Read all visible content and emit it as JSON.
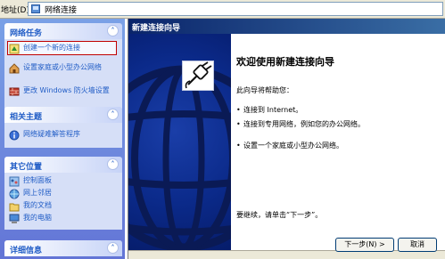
{
  "address_bar": {
    "label": "地址(D)",
    "path": "网络连接"
  },
  "task_pane": {
    "network_tasks": {
      "title": "网络任务",
      "items": [
        {
          "label": "创建一个新的连接",
          "icon": "new-connection-icon"
        },
        {
          "label": "设置家庭或小型办公网络",
          "icon": "home-network-icon"
        },
        {
          "label": "更改 Windows 防火墙设置",
          "icon": "firewall-icon"
        }
      ]
    },
    "related_topics": {
      "title": "相关主题",
      "items": [
        {
          "label": "网络疑难解答程序",
          "icon": "info-icon"
        }
      ]
    },
    "other_places": {
      "title": "其它位置",
      "items": [
        {
          "label": "控制面板",
          "icon": "control-panel-icon"
        },
        {
          "label": "网上邻居",
          "icon": "network-places-icon"
        },
        {
          "label": "我的文档",
          "icon": "my-documents-icon"
        },
        {
          "label": "我的电脑",
          "icon": "my-computer-icon"
        }
      ]
    },
    "details": {
      "title": "详细信息"
    }
  },
  "wizard": {
    "title": "新建连接向导",
    "heading": "欢迎使用新建连接向导",
    "intro": "此向导将帮助您：",
    "bullets": [
      "连接到 Internet。",
      "连接到专用网络，例如您的办公网络。",
      "设置一个家庭或小型办公网络。"
    ],
    "continue_text": "要继续，请单击“下一步”。",
    "buttons": {
      "next": "下一步(N) >",
      "cancel": "取消"
    }
  },
  "colors": {
    "task_pane_bg": "#6375d6",
    "panel_title": "#215dc6",
    "wizard_banner": "#0b2a8a",
    "wizard_titlebar": "#0a246a",
    "selection_outline": "#c00000"
  }
}
